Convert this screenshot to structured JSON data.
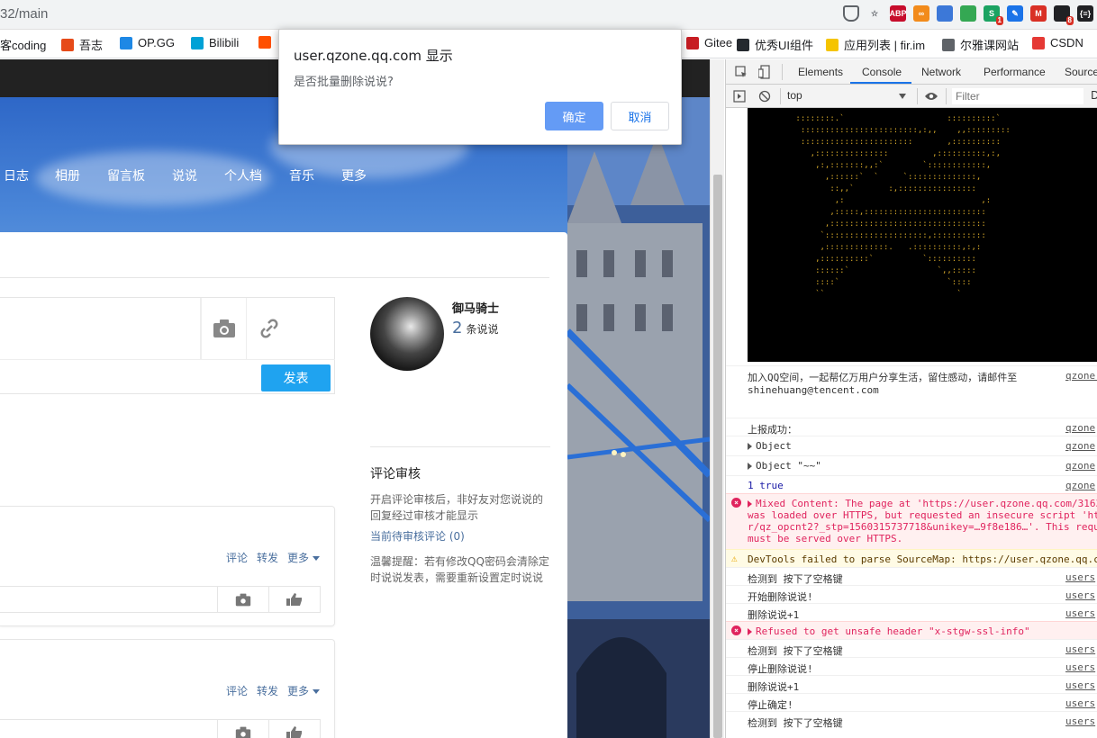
{
  "browser": {
    "url_fragment": "32/main",
    "extensions": [
      {
        "name": "shield-icon",
        "label": "",
        "color": "#5f6368"
      },
      {
        "name": "star-icon",
        "label": "☆",
        "color": "#5f6368"
      },
      {
        "name": "abp-icon",
        "label": "ABP",
        "color": "#c70d2c"
      },
      {
        "name": "infinity-icon",
        "label": "∞",
        "color": "#f28b1b"
      },
      {
        "name": "ext-blue-icon",
        "label": "",
        "color": "#3c78d8"
      },
      {
        "name": "ext-green-icon",
        "label": "",
        "color": "#34a853"
      },
      {
        "name": "ext-s-icon",
        "label": "S",
        "color": "#1ba362",
        "badge": "1"
      },
      {
        "name": "pen-icon",
        "label": "✎",
        "color": "#1a73e8"
      },
      {
        "name": "gmail-icon",
        "label": "M",
        "color": "#d93025"
      },
      {
        "name": "ext-dark-icon",
        "label": "",
        "color": "#202124",
        "badge": "8"
      },
      {
        "name": "braces-icon",
        "label": "{≡}",
        "color": "#202124"
      }
    ]
  },
  "bookmarks": [
    {
      "label": "客coding",
      "icon": "coding-icon",
      "color": "#ffffff"
    },
    {
      "label": "吾志",
      "icon": "flower-icon",
      "color": "#e64a19"
    },
    {
      "label": "OP.GG",
      "icon": "opgg-icon",
      "color": "#1e88e5"
    },
    {
      "label": "Bilibili",
      "icon": "bilibili-icon",
      "color": "#00a1d6"
    },
    {
      "label": "",
      "icon": "taobao-icon",
      "color": "#ff5000"
    },
    {
      "label": "Gitee",
      "icon": "gitee-icon",
      "color": "#c71d23"
    },
    {
      "label": "优秀UI组件",
      "icon": "github-icon",
      "color": "#24292e"
    },
    {
      "label": "应用列表 | fir.im",
      "icon": "fir-icon",
      "color": "#f5c400"
    },
    {
      "label": "尔雅课网站",
      "icon": "globe-icon",
      "color": "#5f6368"
    },
    {
      "label": "CSDN",
      "icon": "csdn-icon",
      "color": "#e53935"
    }
  ],
  "dialog": {
    "title": "user.qzone.qq.com 显示",
    "message": "是否批量删除说说?",
    "ok_label": "确定",
    "cancel_label": "取消"
  },
  "nav": [
    "日志",
    "相册",
    "留言板",
    "说说",
    "个人档",
    "音乐",
    "更多"
  ],
  "composer": {
    "publish_label": "发表"
  },
  "feed": {
    "actions": [
      "评论",
      "转发",
      "更多"
    ]
  },
  "profile": {
    "name": "御马骑士",
    "count": "2",
    "count_unit": "条说说"
  },
  "sidebar": {
    "title": "评论审核",
    "description": "开启评论审核后，非好友对您说说的回复经过审核才能显示",
    "pending_link": "当前待审核评论 (0)",
    "tip": "温馨提醒：若有修改QQ密码会清除定时说说发表，需要重新设置定时说说"
  },
  "devtools": {
    "tabs": [
      "Elements",
      "Console",
      "Network",
      "Performance",
      "Source"
    ],
    "active_tab": "Console",
    "context": "top",
    "filter_placeholder": "Filter",
    "filter_extra": "D",
    "ascii_art": " ::::::::.`                     ::::::::::`\n  ::::::::::::::::::::::::,:,,    ,,:::::::::\n  :::::::::::::::::::::::       ,::::::::::\n    ,:::::::::::::::         ,::::::::::,:,\n     ,:,:::::::,,:`        `::::::::::::,\n       ,::::::`  `     `::::::::::::::,\n        ::,,`       :,::::::::::::::::\n         ,:                            ,:\n        ,:::::,:::::::::::::::::::::::::\n       ,::::::::::::::::::::::::::::::::\n      `:::::::::::::::::::::,:::::::::::\n      ,:::::::::::::.   .::::::::::,:,:\n     ,::::::::::`          `::::::::::\n     ::::::`                  `,,:::::\n     ::::`                      `::::\n     ``                           `",
    "logs": [
      {
        "type": "info",
        "text": "加入QQ空间，一起帮亿万用户分享生活，留住感动，请邮件至\nshinehuang@tencent.com",
        "source": "qzone.",
        "height": 58
      },
      {
        "type": "info",
        "text": "上报成功：",
        "source": "qzone",
        "height": 20
      },
      {
        "type": "info",
        "text": "Object",
        "source": "qzone",
        "height": 22,
        "expandable": true
      },
      {
        "type": "info",
        "text": "Object \"~~\"",
        "source": "qzone",
        "height": 22,
        "expandable": true
      },
      {
        "type": "info",
        "text": "1 true",
        "source": "qzone",
        "height": 20,
        "blue": true
      },
      {
        "type": "error",
        "text": "Mixed Content: The page at 'https://user.qzone.qq.com/3163\nwas loaded over HTTPS, but requested an insecure script 'ht\nr/qz_opcnt2?_stp=1560315737718&unikey=…9f8e186…'. This requ\nmust be served over HTTPS.",
        "source": "",
        "height": 62,
        "expandable": true
      },
      {
        "type": "warning",
        "text": "DevTools failed to parse SourceMap: https://user.qzone.qq.c",
        "source": "",
        "height": 20
      },
      {
        "type": "info",
        "text": "检测到 按下了空格键",
        "source": "users",
        "height": 20
      },
      {
        "type": "info",
        "text": "开始删除说说!",
        "source": "users",
        "height": 20
      },
      {
        "type": "info",
        "text": "删除说说+1",
        "source": "users",
        "height": 20
      },
      {
        "type": "error",
        "text": "Refused to get unsafe header \"x-stgw-ssl-info\"",
        "source": "",
        "height": 20,
        "expandable": true
      },
      {
        "type": "info",
        "text": "检测到 按下了空格键",
        "source": "users",
        "height": 20
      },
      {
        "type": "info",
        "text": "停止删除说说!",
        "source": "users",
        "height": 20
      },
      {
        "type": "info",
        "text": "删除说说+1",
        "source": "users",
        "height": 20
      },
      {
        "type": "info",
        "text": "停止确定!",
        "source": "users",
        "height": 20
      },
      {
        "type": "info",
        "text": "检测到 按下了空格键",
        "source": "users",
        "height": 20
      }
    ]
  }
}
